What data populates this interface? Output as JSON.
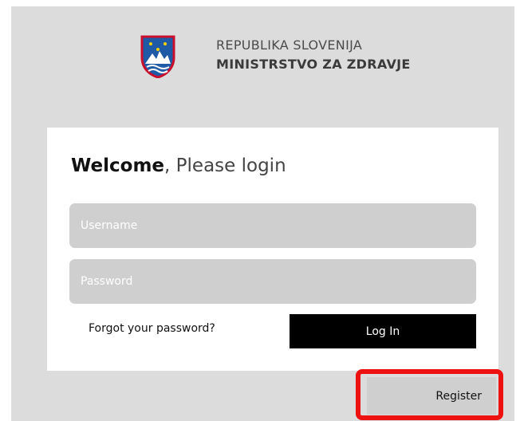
{
  "header": {
    "line1": "REPUBLIKA SLOVENIJA",
    "line2": "MINISTRSTVO ZA ZDRAVJE",
    "crest_icon": "slovenia-coat-of-arms-icon"
  },
  "login": {
    "title_bold": "Welcome",
    "title_rest": ", Please login",
    "username_placeholder": "Username",
    "password_placeholder": "Password",
    "forgot_label": "Forgot your password?",
    "login_label": "Log In"
  },
  "register": {
    "label": "Register",
    "highlight_color": "#ee1111"
  },
  "colors": {
    "page_background": "#dcdcdc",
    "card_background": "#ffffff",
    "field_background": "#cfcfcf",
    "login_button": "#000000"
  }
}
